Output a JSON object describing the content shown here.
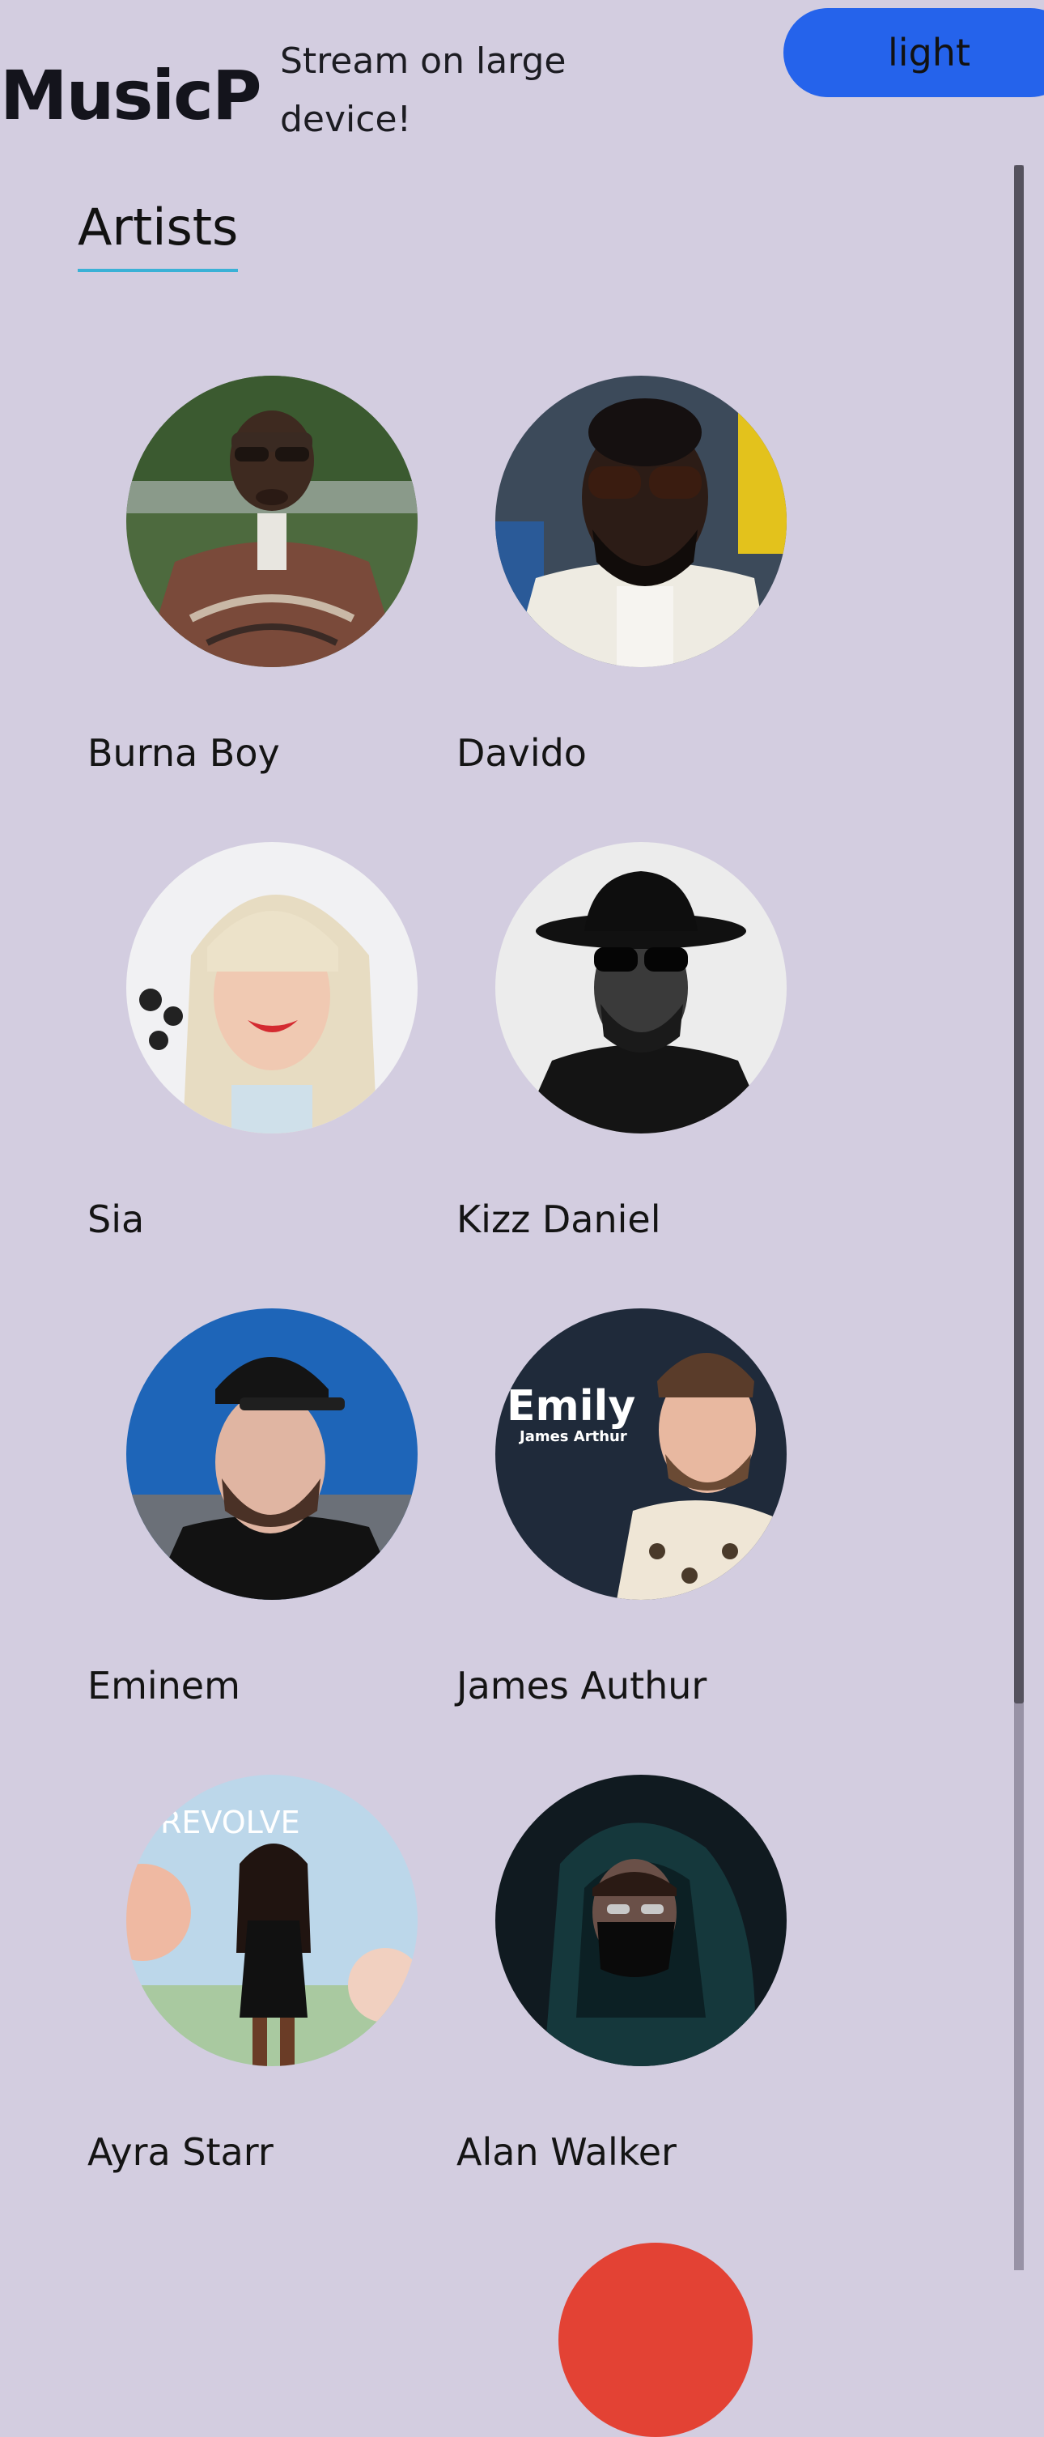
{
  "header": {
    "brand": "MusicPlayer",
    "promo": "Stream on large device!",
    "theme_toggle": "light"
  },
  "section": {
    "title": "Artists"
  },
  "artists": [
    {
      "name": "Burna Boy"
    },
    {
      "name": "Davido"
    },
    {
      "name": "Sia"
    },
    {
      "name": "Kizz Daniel"
    },
    {
      "name": "Eminem"
    },
    {
      "name": "James Authur"
    },
    {
      "name": "Ayra Starr"
    },
    {
      "name": "Alan Walker"
    }
  ],
  "photo_badges": {
    "james_authur_poster_title": "Emily",
    "james_authur_poster_subtitle": "James Arthur",
    "ayra_starr_backdrop": "REVOLVE"
  },
  "colors": {
    "background": "#d3cde0",
    "theme_button": "#2563eb",
    "title_underline": "#3ab1d6",
    "scrollbar_thumb": "#55525e",
    "fab": "#e34234"
  }
}
